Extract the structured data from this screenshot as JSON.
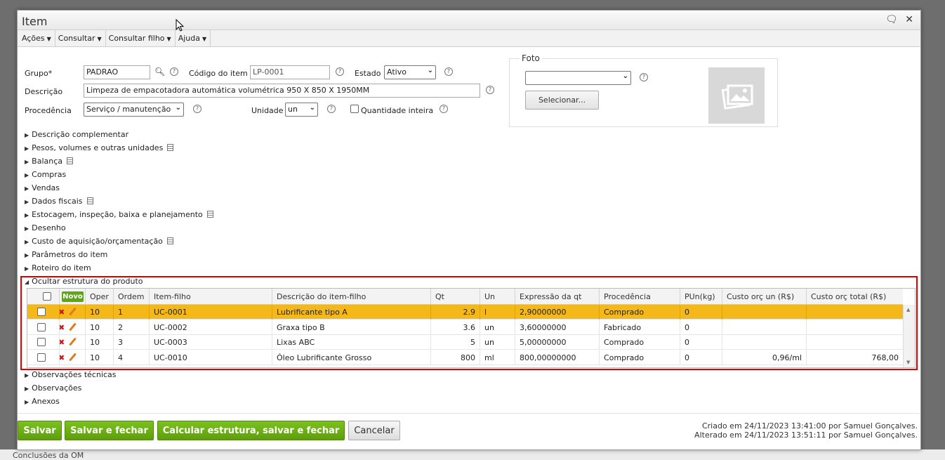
{
  "dialog": {
    "title": "Item"
  },
  "menu": [
    "Ações",
    "Consultar",
    "Consultar filho",
    "Ajuda"
  ],
  "form": {
    "grupo_label": "Grupo*",
    "grupo_value": "PADRAO",
    "codigo_label": "Código do item",
    "codigo_value": "LP-0001",
    "estado_label": "Estado",
    "estado_value": "Ativo",
    "descricao_label": "Descrição",
    "descricao_value": "Limpeza de empacotadora automática volumétrica 950 X 850 X 1950MM",
    "procedencia_label": "Procedência",
    "procedencia_value": "Serviço / manutenção",
    "unidade_label": "Unidade",
    "unidade_value": "un",
    "qtd_inteira_label": "Quantidade inteira"
  },
  "foto": {
    "legend": "Foto",
    "select_value": "",
    "button": "Selecionar..."
  },
  "sections": [
    {
      "label": "Descrição complementar",
      "doc": false
    },
    {
      "label": "Pesos, volumes e outras unidades",
      "doc": true
    },
    {
      "label": "Balança",
      "doc": true
    },
    {
      "label": "Compras",
      "doc": false
    },
    {
      "label": "Vendas",
      "doc": false
    },
    {
      "label": "Dados fiscais",
      "doc": true
    },
    {
      "label": "Estocagem, inspeção, baixa e planejamento",
      "doc": true
    },
    {
      "label": "Desenho",
      "doc": false
    },
    {
      "label": "Custo de aquisição/orçamentação",
      "doc": true
    },
    {
      "label": "Parâmetros do item",
      "doc": false
    },
    {
      "label": "Roteiro do item",
      "doc": false
    },
    {
      "label": "Ocultar estrutura do produto",
      "doc": false
    }
  ],
  "sections_after": [
    "Observações técnicas",
    "Observações",
    "Anexos"
  ],
  "grid": {
    "novo": "Novo",
    "headers": [
      "Oper",
      "Ordem",
      "Item-filho",
      "Descrição do item-filho",
      "Qt",
      "Un",
      "Expressão da qt",
      "Procedência",
      "PUn(kg)",
      "Custo orç un (R$)",
      "Custo orç total (R$)"
    ],
    "rows": [
      [
        "10",
        "1",
        "UC-0001",
        "Lubrificante tipo A",
        "2.9",
        "l",
        "2,90000000",
        "Comprado",
        "0",
        "",
        ""
      ],
      [
        "10",
        "2",
        "UC-0002",
        "Graxa tipo B",
        "3.6",
        "un",
        "3,60000000",
        "Fabricado",
        "0",
        "",
        ""
      ],
      [
        "10",
        "3",
        "UC-0003",
        "Lixas ABC",
        "5",
        "un",
        "5,00000000",
        "Comprado",
        "0",
        "",
        ""
      ],
      [
        "10",
        "4",
        "UC-0010",
        "Óleo Lubrificante Grosso",
        "800",
        "ml",
        "800,00000000",
        "Comprado",
        "0",
        "0,96/ml",
        "768,00"
      ]
    ]
  },
  "footer": {
    "salvar": "Salvar",
    "salvar_fechar": "Salvar e fechar",
    "calcular": "Calcular estrutura, salvar e fechar",
    "cancelar": "Cancelar",
    "criado": "Criado em 24/11/2023 13:41:00 por Samuel Gonçalves.",
    "alterado": "Alterado em 24/11/2023 13:51:11 por Samuel Gonçalves."
  },
  "background": {
    "bottom_text": "Conclusões da OM"
  }
}
